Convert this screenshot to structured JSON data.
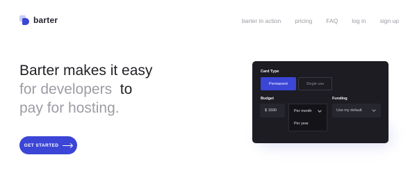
{
  "brand": {
    "name": "barter"
  },
  "nav": {
    "items": [
      "barter in action",
      "pricing",
      "FAQ",
      "log in",
      "sign up"
    ]
  },
  "hero": {
    "line1": "Barter makes it easy",
    "line2_muted": "for developers",
    "line2_dark": "to",
    "line3_muted": "pay for hosting."
  },
  "cta": {
    "label": "GET STARTED"
  },
  "card": {
    "card_type_label": "Card Type",
    "card_type_options": [
      "Permanent",
      "Single use"
    ],
    "budget_label": "Budget",
    "budget_value": "$ 1500",
    "budget_period_options": [
      "Per month",
      "Per year"
    ],
    "funding_label": "Funding",
    "funding_value": "Use my default"
  },
  "colors": {
    "accent": "#3b45d6",
    "card_bg": "#1c1c22"
  }
}
